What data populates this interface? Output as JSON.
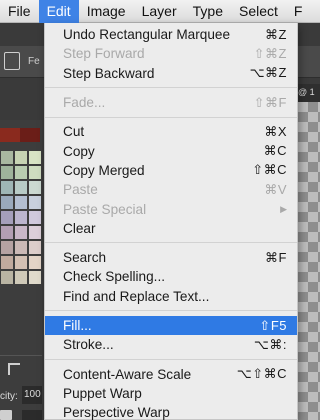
{
  "menubar": {
    "items": [
      "File",
      "Edit",
      "Image",
      "Layer",
      "Type",
      "Select",
      "F"
    ],
    "selected_index": 1
  },
  "background": {
    "options_text": "Fe",
    "tab_text": "@ 1",
    "opacity_label": "city:",
    "opacity_value": "100"
  },
  "edit_menu": {
    "groups": [
      [
        {
          "label": "Undo Rectangular Marquee",
          "shortcut": "⌘Z",
          "enabled": true
        },
        {
          "label": "Step Forward",
          "shortcut": "⇧⌘Z",
          "enabled": false
        },
        {
          "label": "Step Backward",
          "shortcut": "⌥⌘Z",
          "enabled": true
        }
      ],
      [
        {
          "label": "Fade...",
          "shortcut": "⇧⌘F",
          "enabled": false
        }
      ],
      [
        {
          "label": "Cut",
          "shortcut": "⌘X",
          "enabled": true
        },
        {
          "label": "Copy",
          "shortcut": "⌘C",
          "enabled": true
        },
        {
          "label": "Copy Merged",
          "shortcut": "⇧⌘C",
          "enabled": true
        },
        {
          "label": "Paste",
          "shortcut": "⌘V",
          "enabled": false
        },
        {
          "label": "Paste Special",
          "shortcut": "",
          "enabled": false,
          "submenu": true
        },
        {
          "label": "Clear",
          "shortcut": "",
          "enabled": true
        }
      ],
      [
        {
          "label": "Search",
          "shortcut": "⌘F",
          "enabled": true
        },
        {
          "label": "Check Spelling...",
          "shortcut": "",
          "enabled": true
        },
        {
          "label": "Find and Replace Text...",
          "shortcut": "",
          "enabled": true
        }
      ],
      [
        {
          "label": "Fill...",
          "shortcut": "⇧F5",
          "enabled": true,
          "highlighted": true
        },
        {
          "label": "Stroke...",
          "shortcut": "⌥⌘:",
          "enabled": true
        }
      ],
      [
        {
          "label": "Content-Aware Scale",
          "shortcut": "⌥⇧⌘C",
          "enabled": true
        },
        {
          "label": "Puppet Warp",
          "shortcut": "",
          "enabled": true
        },
        {
          "label": "Perspective Warp",
          "shortcut": "",
          "enabled": true
        }
      ]
    ]
  },
  "colors": {
    "menu_highlight": "#2f7ae4",
    "menubar_selected": "#3f83e6",
    "disabled_text": "#a9a9a9",
    "swatches": [
      "#a9b7a0",
      "#c7d3b3",
      "#d8e3c4",
      "#9fb39b",
      "#b9ccb0",
      "#cfdcc0",
      "#9fb6b5",
      "#b8cbc6",
      "#cbd9d1",
      "#9aa9bb",
      "#b3bed0",
      "#c8d0dd",
      "#a59fba",
      "#bcb5cd",
      "#d0c9dc",
      "#b39fb3",
      "#c9b7c7",
      "#dccfd9",
      "#b5a2a2",
      "#cbb9b6",
      "#dccdca",
      "#c0aa9e",
      "#d3c0b3",
      "#e3d4c7",
      "#b9b4a3",
      "#cfc9b8",
      "#e0dacb"
    ]
  }
}
